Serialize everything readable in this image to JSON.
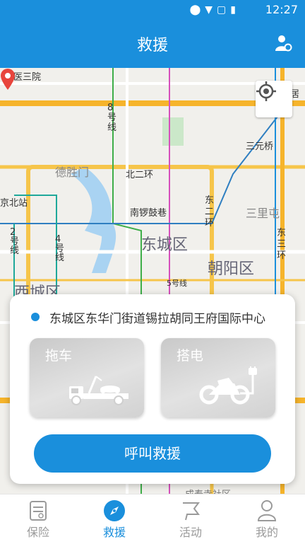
{
  "status_bar": {
    "time": "12:27",
    "icons": [
      "location-icon",
      "wifi-icon",
      "no-sim-icon",
      "battery-charging-icon"
    ]
  },
  "header": {
    "title": "救援",
    "right_icon": "person-settings-icon"
  },
  "map": {
    "labels": [
      "北医三院",
      "宜家家居",
      "8号线",
      "三元桥",
      "德胜门",
      "北二环",
      "东二环",
      "京北站",
      "三里屯",
      "南锣鼓巷",
      "2号线",
      "4号线",
      "东城区",
      "东三环",
      "朝阳区",
      "西城区",
      "5号线",
      "成寿寺社区"
    ],
    "locate_icon": "crosshair-icon",
    "pin_icon": "map-pin-icon",
    "pin_color": "#e8453c"
  },
  "card": {
    "address": "东城区东华门街道锡拉胡同王府国际中心",
    "services": [
      {
        "label": "拖车",
        "icon": "tow-truck-icon"
      },
      {
        "label": "搭电",
        "icon": "motorcycle-charging-icon"
      }
    ],
    "call_button": "呼叫救援"
  },
  "tabs": [
    {
      "label": "保险",
      "icon": "insurance-doc-icon",
      "active": false
    },
    {
      "label": "救援",
      "icon": "compass-icon",
      "active": true
    },
    {
      "label": "活动",
      "icon": "flag-icon",
      "active": false
    },
    {
      "label": "我的",
      "icon": "user-icon",
      "active": false
    }
  ],
  "colors": {
    "primary": "#1a8fdc",
    "pin": "#e8453c"
  }
}
